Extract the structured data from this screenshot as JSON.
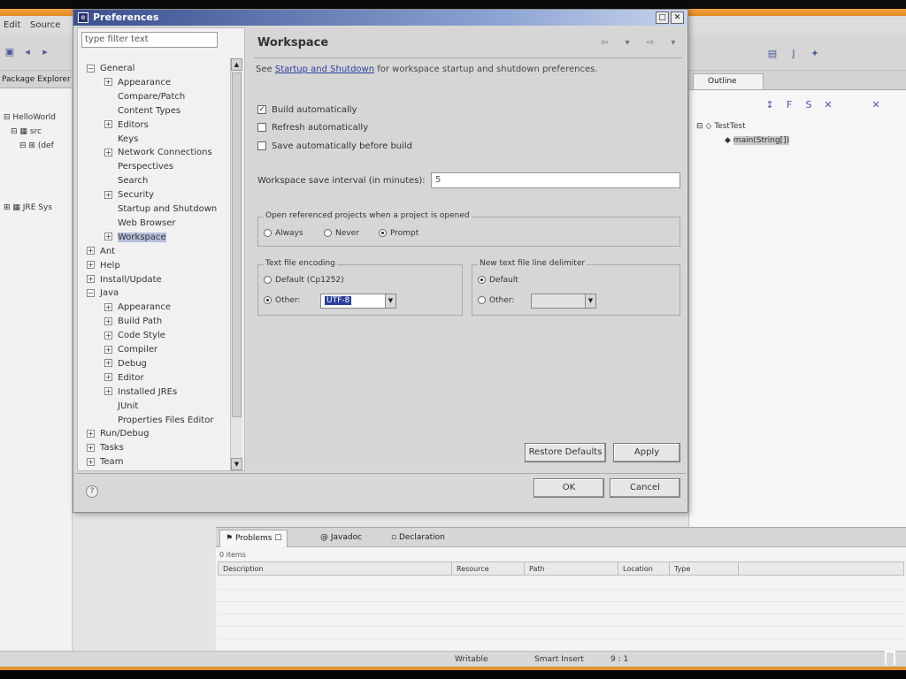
{
  "eclipse": {
    "menu": [
      "Edit",
      "Source"
    ],
    "package_explorer": {
      "tab_label": "Package Explorer",
      "rows": [
        "HelloWorld",
        "src",
        "(def",
        "JRE Sys"
      ]
    },
    "outline": {
      "tab_label": "Outline",
      "rows": [
        "TestTest",
        "main(String[])"
      ]
    },
    "problems": {
      "tabs": [
        "Problems",
        "Javadoc",
        "Declaration"
      ],
      "items": "0 items",
      "columns": [
        "Description",
        "Resource",
        "Path",
        "Location",
        "Type"
      ]
    },
    "status": {
      "writable": "Writable",
      "insert_mode": "Smart Insert",
      "position": "9 : 1"
    }
  },
  "dialog": {
    "title": "Preferences",
    "filter_placeholder": "type filter text",
    "tree": [
      {
        "label": "General",
        "exp": "−",
        "indent": 0
      },
      {
        "label": "Appearance",
        "exp": "+",
        "indent": 1
      },
      {
        "label": "Compare/Patch",
        "exp": "",
        "indent": 1
      },
      {
        "label": "Content Types",
        "exp": "",
        "indent": 1
      },
      {
        "label": "Editors",
        "exp": "+",
        "indent": 1
      },
      {
        "label": "Keys",
        "exp": "",
        "indent": 1
      },
      {
        "label": "Network Connections",
        "exp": "+",
        "indent": 1
      },
      {
        "label": "Perspectives",
        "exp": "",
        "indent": 1
      },
      {
        "label": "Search",
        "exp": "",
        "indent": 1
      },
      {
        "label": "Security",
        "exp": "+",
        "indent": 1
      },
      {
        "label": "Startup and Shutdown",
        "exp": "",
        "indent": 1
      },
      {
        "label": "Web Browser",
        "exp": "",
        "indent": 1
      },
      {
        "label": "Workspace",
        "exp": "+",
        "indent": 1,
        "selected": true
      },
      {
        "label": "Ant",
        "exp": "+",
        "indent": 0
      },
      {
        "label": "Help",
        "exp": "+",
        "indent": 0
      },
      {
        "label": "Install/Update",
        "exp": "+",
        "indent": 0
      },
      {
        "label": "Java",
        "exp": "−",
        "indent": 0
      },
      {
        "label": "Appearance",
        "exp": "+",
        "indent": 1
      },
      {
        "label": "Build Path",
        "exp": "+",
        "indent": 1
      },
      {
        "label": "Code Style",
        "exp": "+",
        "indent": 1
      },
      {
        "label": "Compiler",
        "exp": "+",
        "indent": 1
      },
      {
        "label": "Debug",
        "exp": "+",
        "indent": 1
      },
      {
        "label": "Editor",
        "exp": "+",
        "indent": 1
      },
      {
        "label": "Installed JREs",
        "exp": "+",
        "indent": 1
      },
      {
        "label": "JUnit",
        "exp": "",
        "indent": 1
      },
      {
        "label": "Properties Files Editor",
        "exp": "",
        "indent": 1
      },
      {
        "label": "Run/Debug",
        "exp": "+",
        "indent": 0
      },
      {
        "label": "Tasks",
        "exp": "+",
        "indent": 0
      },
      {
        "label": "Team",
        "exp": "+",
        "indent": 0
      }
    ],
    "page": {
      "title": "Workspace",
      "desc_prefix": "See ",
      "desc_link": "Startup and Shutdown",
      "desc_suffix": " for workspace startup and shutdown preferences.",
      "build_auto": "Build automatically",
      "refresh_auto": "Refresh automatically",
      "save_before_build": "Save automatically before build",
      "interval_label": "Workspace save interval (in minutes):",
      "interval_value": "5",
      "open_ref_group": "Open referenced projects when a project is opened",
      "open_ref_options": [
        "Always",
        "Never",
        "Prompt"
      ],
      "encoding_group": "Text file encoding",
      "encoding_default": "Default (Cp1252)",
      "encoding_other": "Other:",
      "encoding_value": "UTF-8",
      "delimiter_group": "New text file line delimiter",
      "delimiter_default": "Default",
      "delimiter_other": "Other:"
    },
    "buttons": {
      "restore": "Restore Defaults",
      "apply": "Apply",
      "ok": "OK",
      "cancel": "Cancel"
    }
  }
}
